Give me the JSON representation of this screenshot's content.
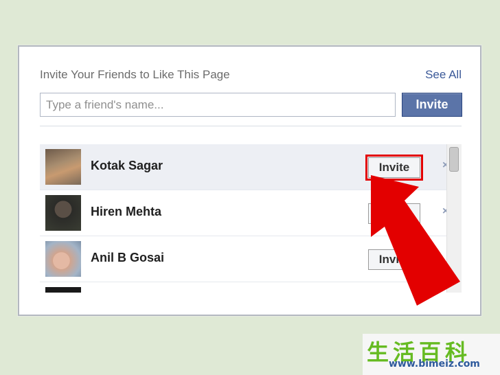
{
  "dialog": {
    "title": "Invite Your Friends to Like This Page",
    "see_all": "See All",
    "search_placeholder": "Type a friend's name...",
    "invite_button": "Invite"
  },
  "friends": [
    {
      "name": "Kotak Sagar",
      "invite_label": "Invite",
      "remove": "×"
    },
    {
      "name": "Hiren Mehta",
      "invite_label": "",
      "remove": "×"
    },
    {
      "name": "Anil B Gosai",
      "invite_label": "Invite",
      "remove": ""
    },
    {
      "name": "",
      "invite_label": "",
      "remove": ""
    }
  ],
  "annotation": {
    "arrow_color": "#e30000"
  },
  "watermark": {
    "chars": "生活百科",
    "url": "www.bimeiz.com"
  }
}
